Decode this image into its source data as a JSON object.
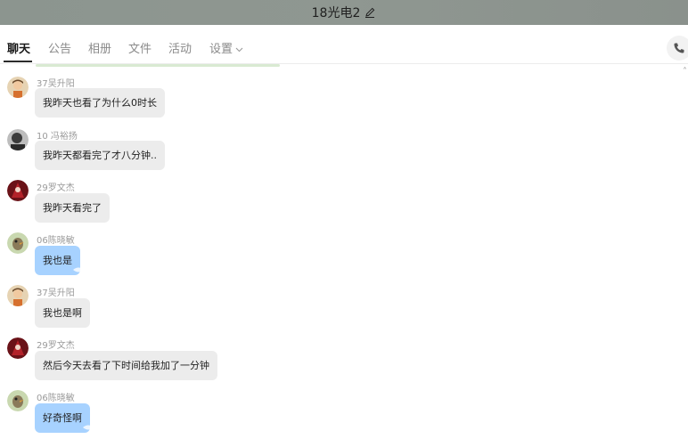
{
  "window": {
    "title": "18光电2"
  },
  "tabs": [
    {
      "label": "聊天",
      "active": true
    },
    {
      "label": "公告"
    },
    {
      "label": "相册"
    },
    {
      "label": "文件"
    },
    {
      "label": "活动"
    },
    {
      "label": "设置"
    }
  ],
  "scroll_hint": "˄",
  "messages": [
    {
      "sender": "37吴升阳",
      "text": "我昨天也看了为什么0时长",
      "avatar": "avatar-cartoon-boy"
    },
    {
      "sender": "10 冯裕扬",
      "text": "我昨天都看完了才八分钟..",
      "avatar": "avatar-grey-portrait"
    },
    {
      "sender": "29罗文杰",
      "text": "我昨天看完了",
      "avatar": "avatar-red-character"
    },
    {
      "sender": "06陈晓敏",
      "text": "我也是",
      "avatar": "avatar-bird-green",
      "highlight": true
    },
    {
      "sender": "37吴升阳",
      "text": "我也是啊",
      "avatar": "avatar-cartoon-boy"
    },
    {
      "sender": "29罗文杰",
      "text": "然后今天去看了下时间给我加了一分钟",
      "avatar": "avatar-red-character"
    },
    {
      "sender": "06陈晓敏",
      "text": "好奇怪啊",
      "avatar": "avatar-bird-green",
      "highlight": true
    }
  ],
  "colors": {
    "titlebar": "#8c958f",
    "bubble_default": "#ececec",
    "bubble_self": "#a7d2ff"
  }
}
